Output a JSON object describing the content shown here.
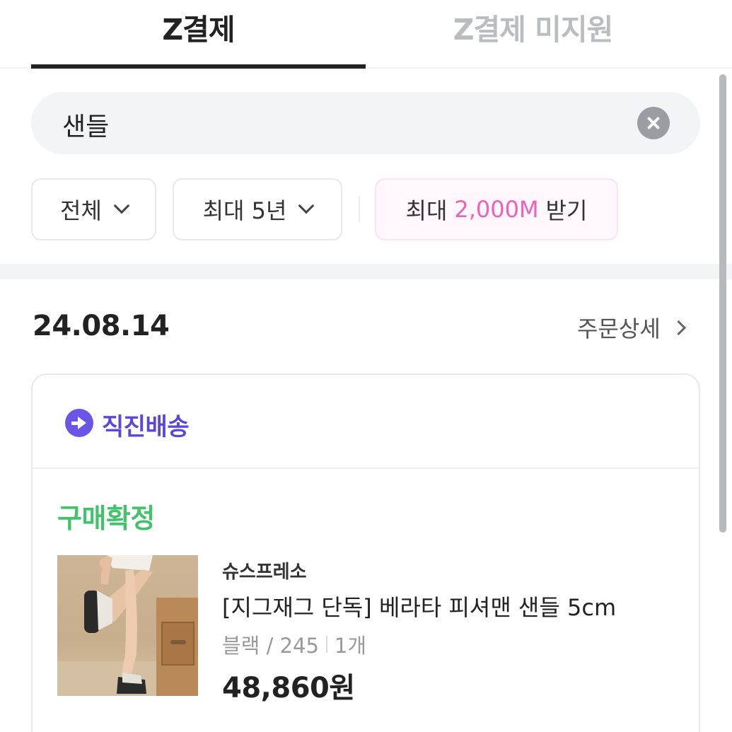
{
  "tabs": [
    {
      "label": "Z결제",
      "active": true
    },
    {
      "label": "Z결제 미지원",
      "active": false
    }
  ],
  "search": {
    "value": "샌들",
    "clear_icon": "close-icon"
  },
  "filters": {
    "period_type": "전체",
    "period_range": "최대 5년",
    "promo_prefix": "최대",
    "promo_amount": "2,000M",
    "promo_suffix": "받기"
  },
  "order": {
    "date": "24.08.14",
    "detail_link": "주문상세",
    "delivery_type": "직진배송",
    "status": "구매확정",
    "item": {
      "brand": "슈스프레소",
      "name": "[지그재그 단독] 베라타 피셔맨 샌들 5cm",
      "option": "블랙 / 245",
      "quantity": "1개",
      "price": "48,860원"
    }
  },
  "colors": {
    "accent_pink": "#f25fb7",
    "delivery_purple": "#5b47db",
    "status_green": "#42c36b"
  }
}
